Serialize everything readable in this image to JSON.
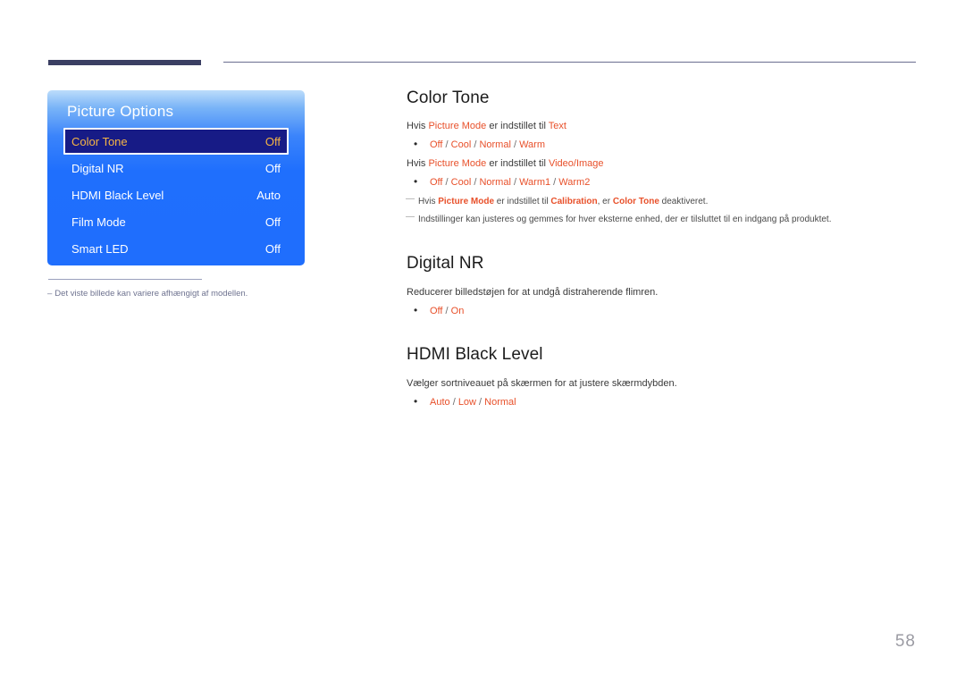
{
  "header": {
    "rule_thick": "",
    "rule_thin": ""
  },
  "osd": {
    "title": "Picture Options",
    "rows": [
      {
        "label": "Color Tone",
        "value": "Off",
        "selected": true
      },
      {
        "label": "Digital NR",
        "value": "Off",
        "selected": false
      },
      {
        "label": "HDMI Black Level",
        "value": "Auto",
        "selected": false
      },
      {
        "label": "Film Mode",
        "value": "Off",
        "selected": false
      },
      {
        "label": "Smart LED",
        "value": "Off",
        "selected": false
      }
    ],
    "note_dash": "–",
    "note": "Det viste billede kan variere afhængigt af modellen."
  },
  "sections": {
    "color_tone": {
      "title": "Color Tone",
      "line1": {
        "pre": "Hvis ",
        "hi1": "Picture Mode",
        "mid": " er indstillet til ",
        "hi2": "Text"
      },
      "options1": "Off / Cool / Normal / Warm",
      "options1_parts": [
        "Off",
        "Cool",
        "Normal",
        "Warm"
      ],
      "line2": {
        "pre": "Hvis ",
        "hi1": "Picture Mode",
        "mid": " er indstillet til ",
        "hi2": "Video/Image"
      },
      "options2": "Off / Cool / Normal / Warm1 / Warm2",
      "options2_parts": [
        "Off",
        "Cool",
        "Normal",
        "Warm1",
        "Warm2"
      ],
      "note1": {
        "pre": "Hvis ",
        "hi1": "Picture Mode",
        "mid": " er indstillet til ",
        "hi2": "Calibration",
        "mid2": ", er ",
        "hi3": "Color Tone",
        "post": " deaktiveret."
      },
      "note2": "Indstillinger kan justeres og gemmes for hver eksterne enhed, der er tilsluttet til en indgang på produktet."
    },
    "digital_nr": {
      "title": "Digital NR",
      "desc": "Reducerer billedstøjen for at undgå distraherende flimren.",
      "options": "Off / On",
      "options_parts": [
        "Off",
        "On"
      ]
    },
    "hdmi_black_level": {
      "title": "HDMI Black Level",
      "desc": "Vælger sortniveauet på skærmen for at justere skærmdybden.",
      "options": "Auto / Low / Normal",
      "options_parts": [
        "Auto",
        "Low",
        "Normal"
      ]
    }
  },
  "footer": {
    "page_number": "58"
  },
  "colors": {
    "accent_orange": "#e8502a",
    "osd_blue": "#1f6efd",
    "osd_selected_bg": "#171b86",
    "osd_selected_text": "#f6b545",
    "rule_navy": "#3b3f63",
    "page_number_gray": "#9b9ba3"
  }
}
